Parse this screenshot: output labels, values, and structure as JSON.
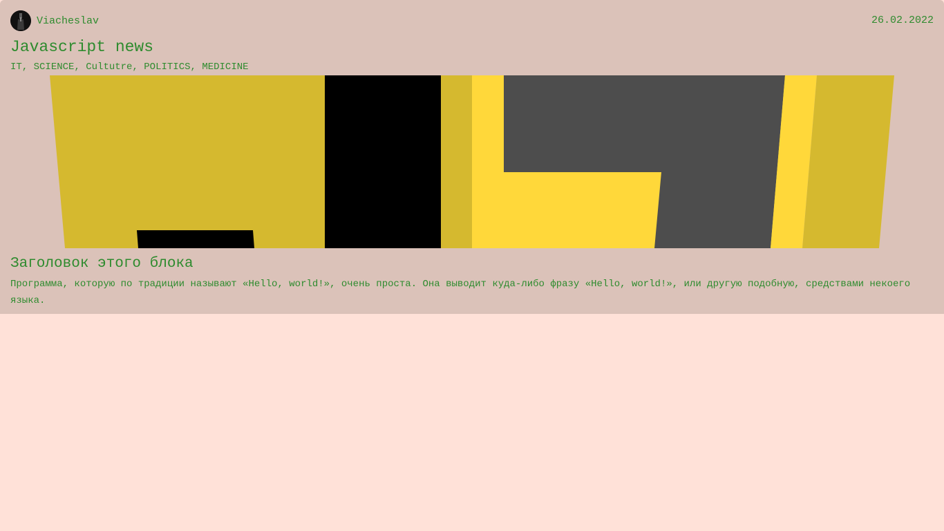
{
  "post": {
    "author": "Viacheslav",
    "date": "26.02.2022",
    "title": "Javascript news",
    "tags": [
      "IT",
      "SCIENCE",
      "Cultutre",
      "POLITICS",
      "MEDICINE"
    ],
    "avatar_icon": "user-avatar-icon",
    "hero_image": "js-logo-image",
    "block_title": "Заголовок этого блока",
    "block_text": "Программа, которую по традиции называют «Hello, world!», очень проста. Она выводит куда-либо фразу «Hello, world!», или другую подобную, средствами некоего языка."
  },
  "colors": {
    "page_background": "#ffe1d8",
    "card_background": "#dbc2b9",
    "text": "#2e8b2e",
    "hero_yellow": "#d5b92f",
    "hero_bright_yellow": "#ffd83a",
    "hero_dark": "#4d4d4d",
    "hero_black": "#000000"
  }
}
